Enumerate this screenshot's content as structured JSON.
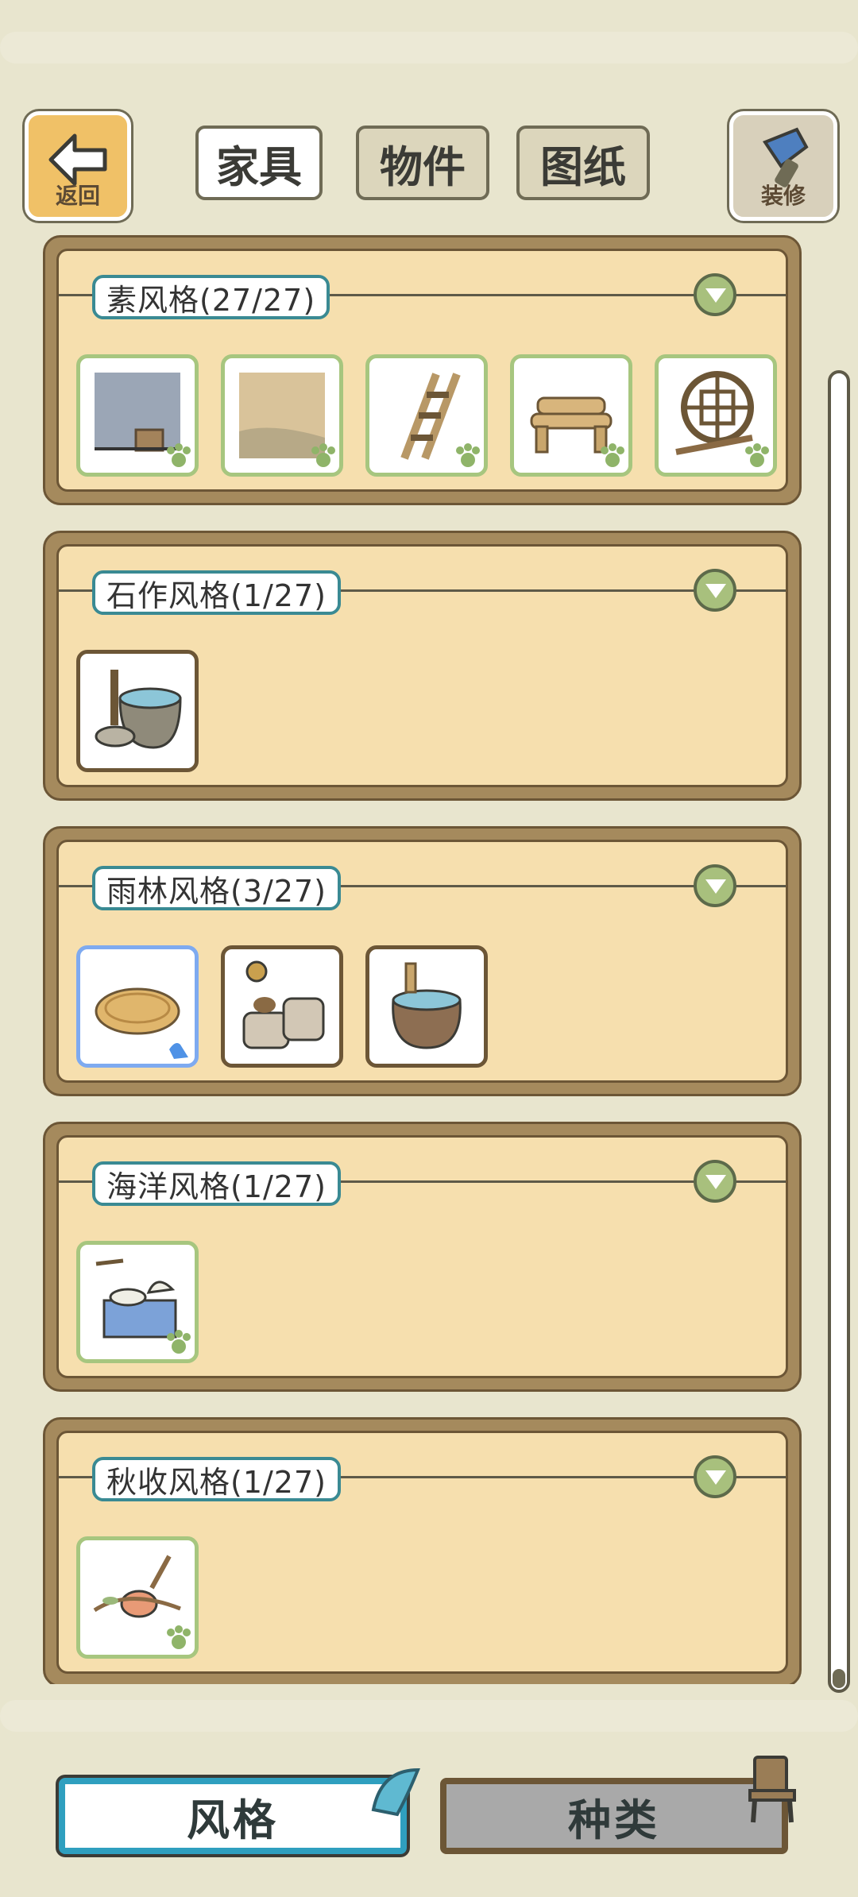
{
  "header": {
    "back_label": "返回",
    "decor_label": "装修",
    "tabs": [
      {
        "label": "家具",
        "active": true
      },
      {
        "label": "物件",
        "active": false
      },
      {
        "label": "图纸",
        "active": false
      }
    ]
  },
  "sections": [
    {
      "title": "素风格(27/27)"
    },
    {
      "title": "石作风格(1/27)"
    },
    {
      "title": "雨林风格(3/27)"
    },
    {
      "title": "海洋风格(1/27)"
    },
    {
      "title": "秋收风格(1/27)"
    }
  ],
  "bottom_tabs": {
    "style_label": "风格",
    "type_label": "种类"
  },
  "colors": {
    "background": "#e8e5ce",
    "panel_fill": "#f6dfae",
    "panel_border": "#a58a5d",
    "owned_border": "#a7c67f",
    "selected_border": "#7eaaf0",
    "title_border": "#3a8a93",
    "active_bottom_tab": "#2f9fbf"
  }
}
